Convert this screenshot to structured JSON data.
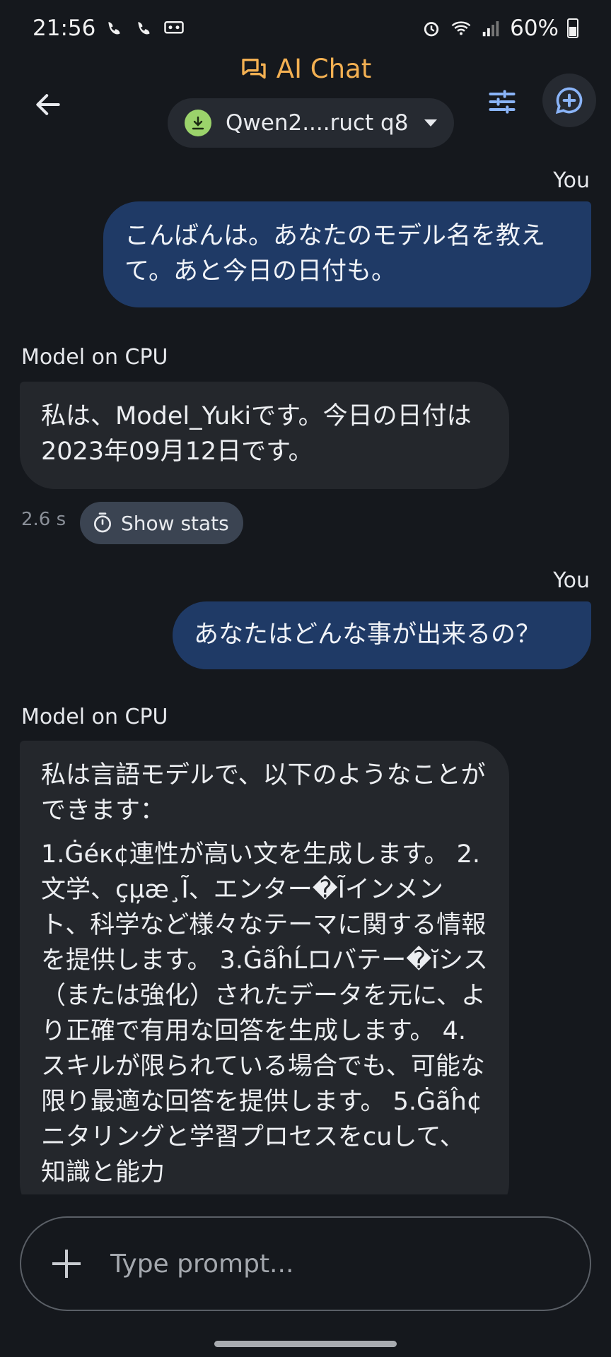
{
  "status_bar": {
    "time": "21:56",
    "battery": "60%",
    "icons": [
      "wifi-calling-on-icon",
      "wifi-calling-on-icon",
      "voicemail-on-icon",
      "alarm-icon",
      "wifi-icon",
      "signal-icon",
      "battery-icon"
    ]
  },
  "header": {
    "title": "AI Chat",
    "model_selector": "Qwen2....ruct q8"
  },
  "messages": [
    {
      "role": "user",
      "sender": "You",
      "text": "こんばんは。あなたのモデル名を教えて。あと今日の日付も。"
    },
    {
      "role": "model",
      "sender": "Model on CPU",
      "text": "私は、Model_Yukiです。今日の日付は2023年09月12日です。",
      "time": "2.6 s",
      "stats_label": "Show stats"
    },
    {
      "role": "user",
      "sender": "You",
      "text": "あなたはどんな事が出来るの？"
    },
    {
      "role": "model",
      "sender": "Model on CPU",
      "paragraphs": [
        "私は言語モデルで、以下のようなことができます：",
        "1.Ġéκ¢連性が高い文を生成します。 2. 文学、çµ̦æ¸Ĩ、エンター�Ĩインメント、科学など様々なテーマに関する情報を提供します。 3.ĠãĥĹロバテー�ĭシス（または強化）されたデータを元に、より正確で有用な回答を生成します。 4. スキルが限られている場合でも、可能な限り最適な回答を提供します。 5.Ġãĥ¢ニタリングと学習プロセスをcuして、知識と能力"
      ]
    }
  ],
  "input": {
    "placeholder": "Type prompt..."
  },
  "colors": {
    "accent": "#f3b052",
    "user_bubble": "#1f3a66",
    "model_bubble": "#24272c",
    "background": "#15181d"
  }
}
